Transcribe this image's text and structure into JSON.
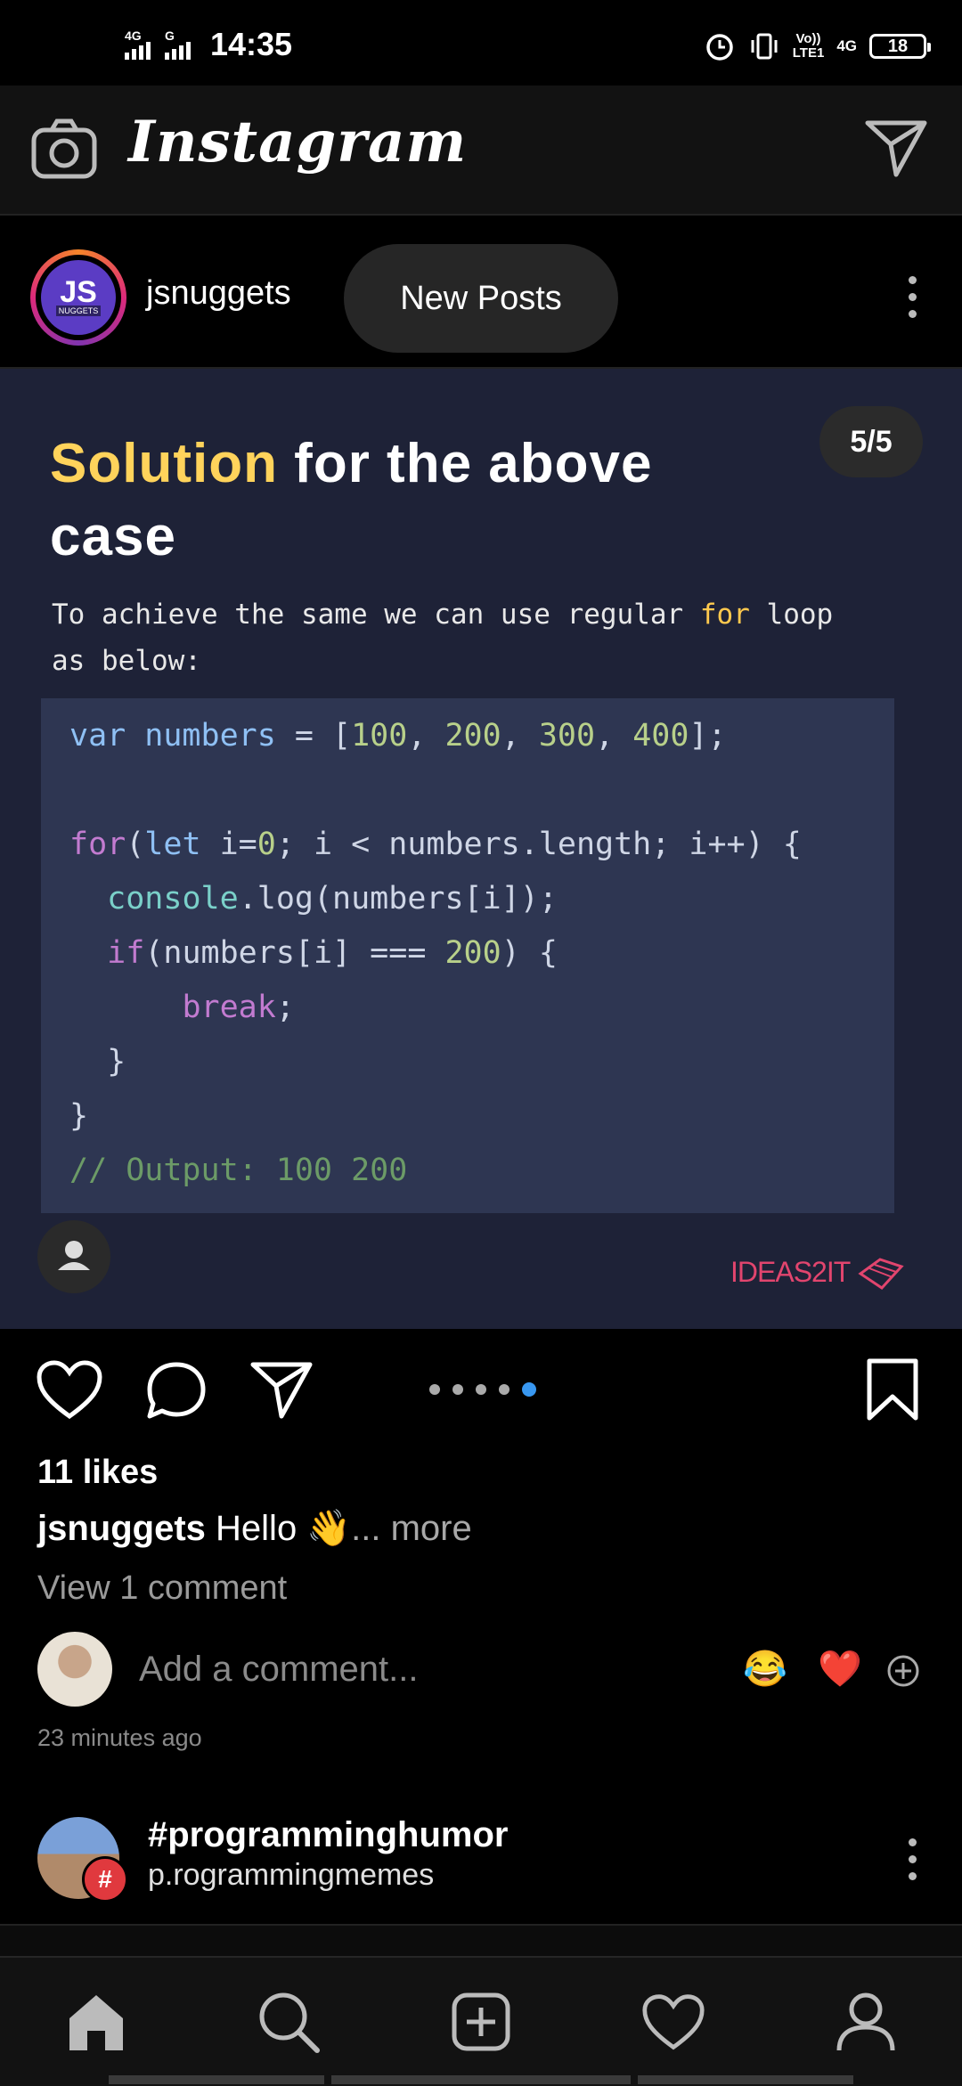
{
  "status_bar": {
    "time": "14:35",
    "net_left_1": "4G",
    "net_left_2": "G",
    "volte_top": "Vo))",
    "volte_bottom": "LTE1",
    "net_right": "4G",
    "battery": "18",
    "icons": [
      "alarm-icon",
      "vibrate-icon"
    ]
  },
  "app_bar": {
    "title": "Instagram",
    "left_icon": "camera-icon",
    "right_icon": "direct-message-icon"
  },
  "post": {
    "username": "jsnuggets",
    "avatar_text": "JS",
    "avatar_subtext": "NUGGETS",
    "new_posts_label": "New Posts",
    "counter": "5/5",
    "headline_highlight": "Solution",
    "headline_rest_1": " for the above",
    "headline_rest_2": "case",
    "desc_1": "To achieve the same we can use regular ",
    "desc_kw": "for",
    "desc_2": " loop",
    "desc_3": "as below:",
    "watermark": "IDEAS2IT",
    "likes": "11 likes",
    "caption_user": "jsnuggets",
    "caption_text": "Hello 👋",
    "caption_more": "... more",
    "view_comments": "View 1 comment",
    "comment_placeholder": "Add a comment...",
    "quick_emojis": [
      "😂",
      "❤️"
    ],
    "time_ago": "23 minutes ago",
    "carousel_count": 5,
    "carousel_active": 5
  },
  "code": {
    "line1": [
      "var",
      " numbers",
      " = [",
      "100",
      ", ",
      "200",
      ", ",
      "300",
      ", ",
      "400",
      "];"
    ],
    "line3": [
      "for",
      "(",
      "let",
      " i=",
      "0",
      "; i < numbers.length; i++) {"
    ],
    "line4": [
      "  ",
      "console",
      ".log(numbers[i]);"
    ],
    "line5": [
      "  ",
      "if",
      "(numbers[i] === ",
      "200",
      ") {"
    ],
    "line6": [
      "      ",
      "break",
      ";"
    ],
    "line7": "  }",
    "line8": "}",
    "line9": "// Output: 100 200"
  },
  "next_post": {
    "title": "#programminghumor",
    "subtitle": "p.rogrammingmemes",
    "badge": "#"
  },
  "bottom_nav": [
    "home-icon",
    "search-icon",
    "new-post-icon",
    "activity-icon",
    "profile-icon"
  ]
}
